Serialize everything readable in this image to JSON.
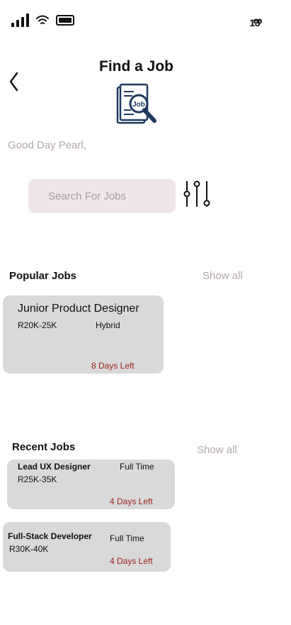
{
  "status_bar": {
    "time": "13"
  },
  "header": {
    "title": "Find a Job",
    "logo_text": "Job"
  },
  "greeting": "Good Day Pearl,",
  "search": {
    "placeholder": "Search For Jobs"
  },
  "popular": {
    "title": "Popular Jobs",
    "show_all": "Show all",
    "jobs": [
      {
        "title": "Junior Product Designer",
        "salary": "R20K-25K",
        "type": "Hybrid",
        "days_left": "8 Days Left"
      }
    ]
  },
  "recent": {
    "title": "Recent Jobs",
    "show_all": "Show all",
    "jobs": [
      {
        "title": "Lead UX Designer",
        "salary": "R25K-35K",
        "type": "Full Time",
        "days_left": "4 Days Left"
      },
      {
        "title": "Full-Stack Developer",
        "salary": "R30K-40K",
        "type": "Full Time",
        "days_left": "4 Days Left"
      }
    ]
  },
  "colors": {
    "accent_red": "#a01e1e",
    "muted": "#b3a8ab",
    "card": "#d9d9d9",
    "search_bg": "#f0e5e7",
    "brand_navy": "#1f3a5f"
  }
}
